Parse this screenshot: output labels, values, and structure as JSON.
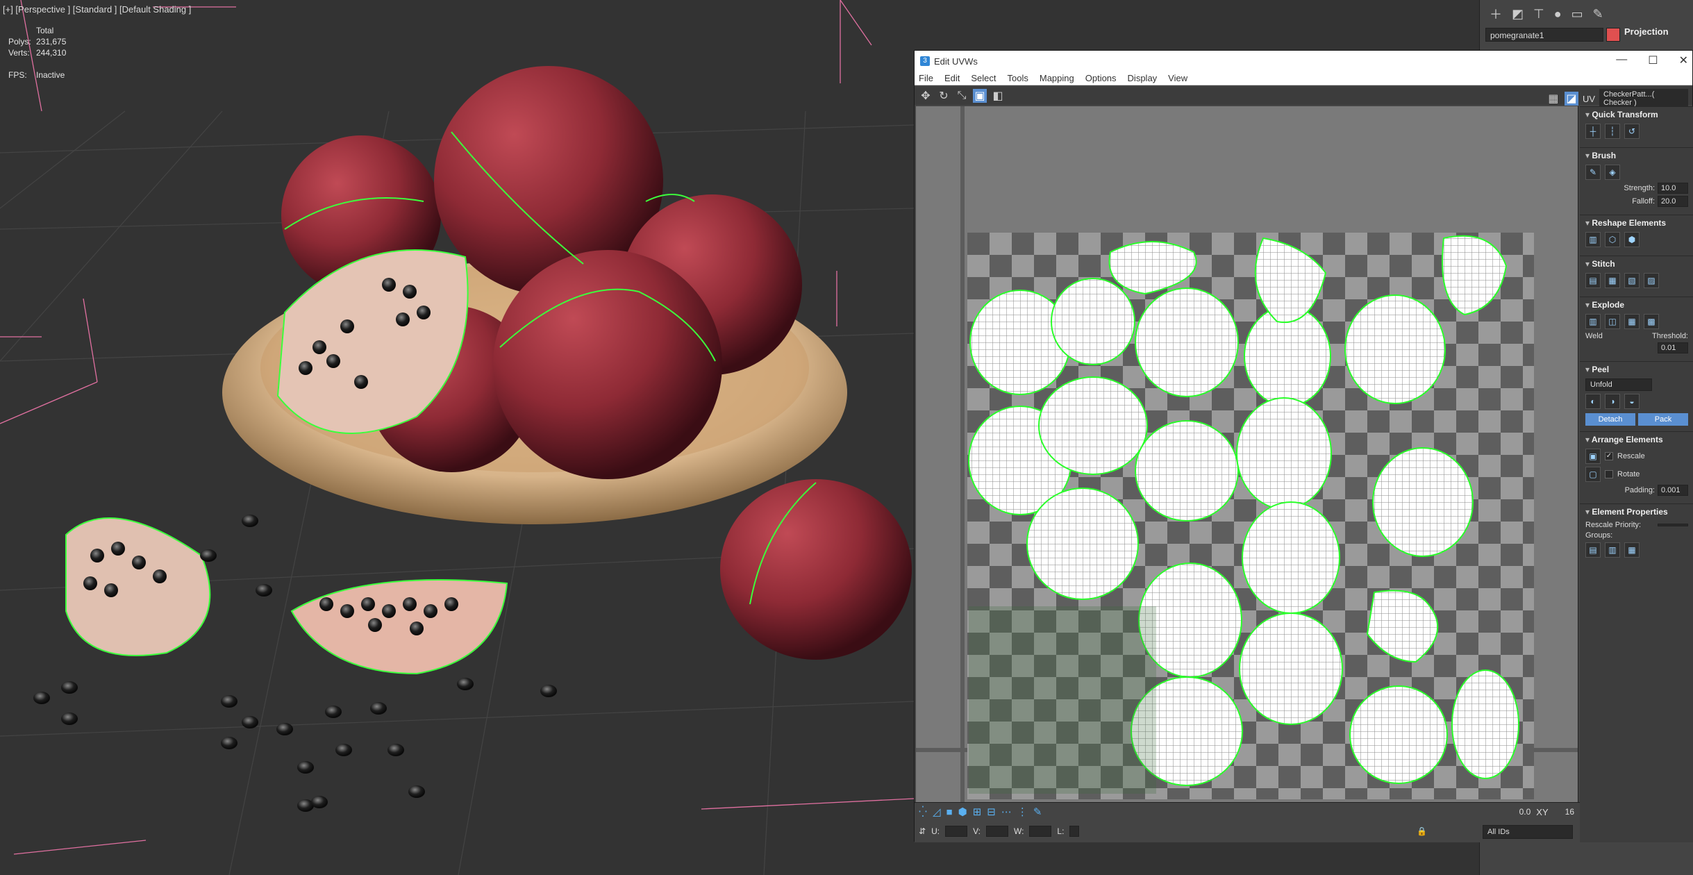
{
  "viewport": {
    "label": "[+] [Perspective ] [Standard ] [Default Shading ]",
    "stats": {
      "total_label": "Total",
      "polys_label": "Polys:",
      "polys_value": "231,675",
      "verts_label": "Verts:",
      "verts_value": "244,310",
      "fps_label": "FPS:",
      "fps_value": "Inactive"
    }
  },
  "command_panel": {
    "object_name": "pomegranate1",
    "rollout_title": "Projection",
    "tab_icons": [
      "create-icon",
      "modify-icon",
      "hierarchy-icon",
      "motion-icon",
      "display-icon",
      "utilities-icon"
    ]
  },
  "uvw_window": {
    "title": "Edit UVWs",
    "menu": [
      "File",
      "Edit",
      "Select",
      "Tools",
      "Mapping",
      "Options",
      "Display",
      "View"
    ],
    "uv_label": "UV",
    "checker_label": "CheckerPatt...( Checker )",
    "side": {
      "quick_transform": "Quick Transform",
      "brush": "Brush",
      "strength_label": "Strength:",
      "strength_value": "10.0",
      "falloff_label": "Falloff:",
      "falloff_value": "20.0",
      "reshape": "Reshape Elements",
      "stitch": "Stitch",
      "explode": "Explode",
      "weld_label": "Weld",
      "threshold_label": "Threshold:",
      "threshold_value": "0.01",
      "peel": "Peel",
      "unfold_value": "Unfold",
      "detach_label": "Detach",
      "pack_label": "Pack",
      "arrange": "Arrange Elements",
      "rescale_label": "Rescale",
      "rotate_label": "Rotate",
      "padding_label": "Padding:",
      "padding_value": "0.001",
      "element_props": "Element Properties",
      "rescale_priority_label": "Rescale Priority:",
      "groups_label": "Groups:"
    },
    "bottom": {
      "u_label": "U:",
      "v_label": "V:",
      "w_label": "W:",
      "l_label": "L:",
      "value_field": "0.0",
      "ids_value": "All IDs",
      "xy_label": "XY",
      "grid_value": "16"
    }
  },
  "colors": {
    "viewport_bg": "#333333",
    "pomegranate": "#8e2a35",
    "bowl": "#d7b48a",
    "seam_green": "#3cff3c",
    "uv_bg": "#7a7a7a",
    "accent_blue": "#5a8fd1"
  }
}
